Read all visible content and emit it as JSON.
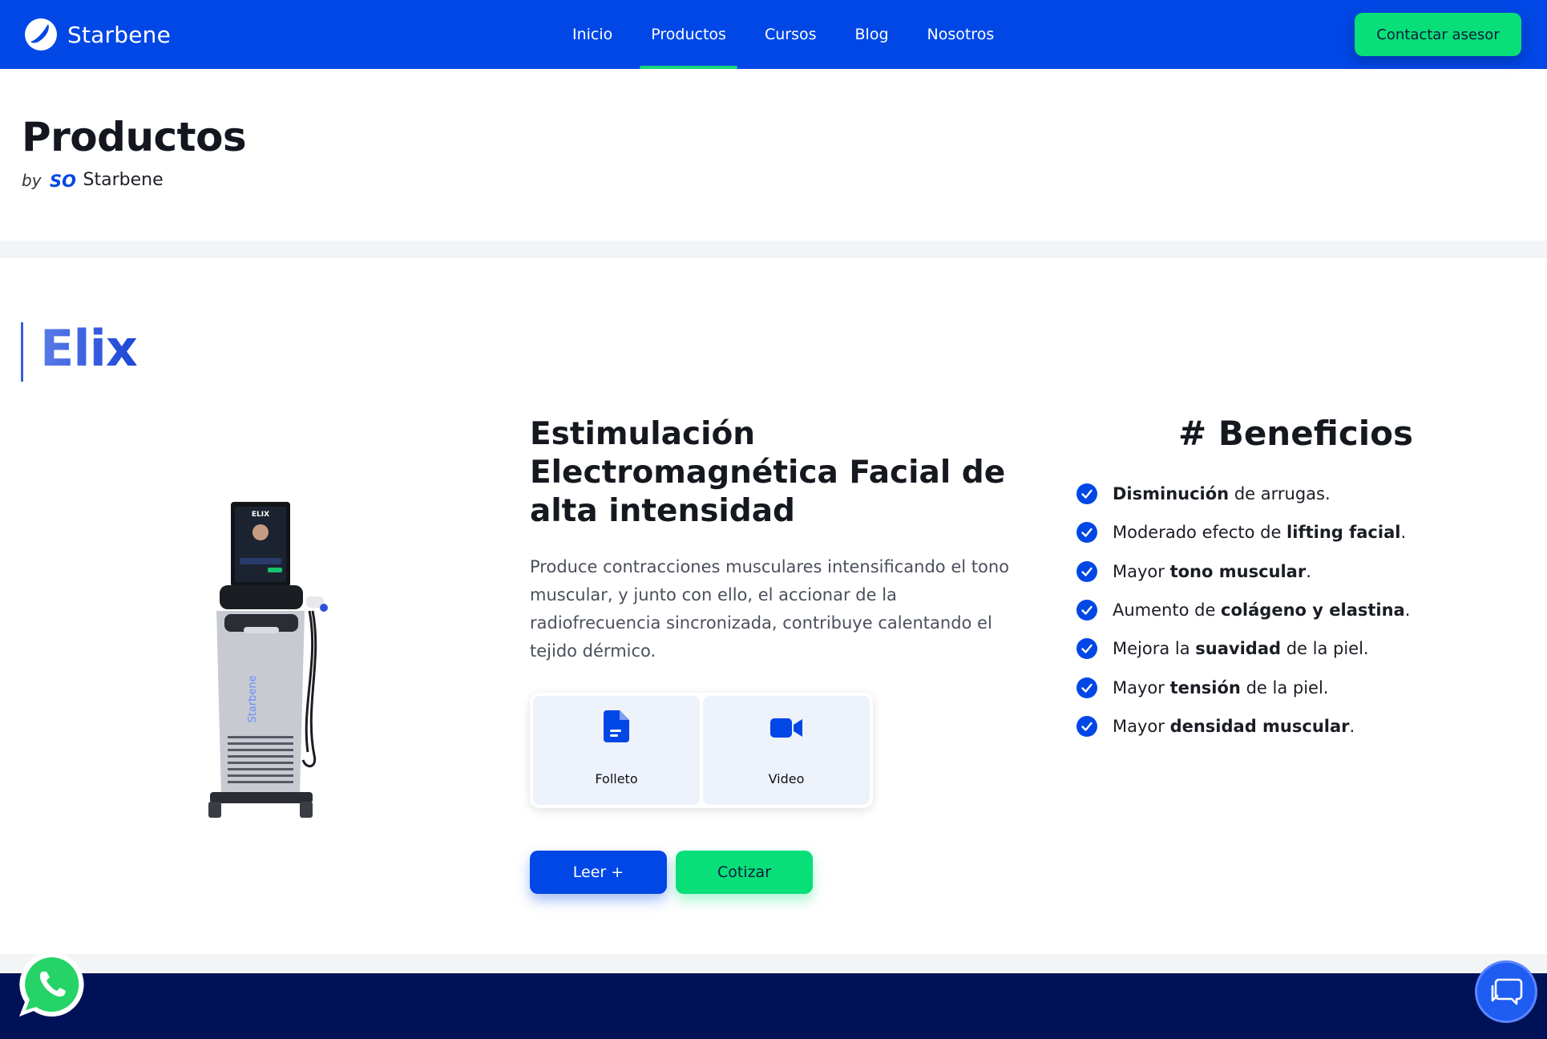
{
  "brand": {
    "name": "Starbene",
    "logo_icon": "swoosh-logo-icon"
  },
  "nav": {
    "items": [
      {
        "label": "Inicio",
        "active": false
      },
      {
        "label": "Productos",
        "active": true
      },
      {
        "label": "Cursos",
        "active": false
      },
      {
        "label": "Blog",
        "active": false
      },
      {
        "label": "Nosotros",
        "active": false
      }
    ],
    "cta_label": "Contactar asesor"
  },
  "page": {
    "title": "Productos",
    "by_word": "by",
    "by_brand": "Starbene",
    "by_logo_text": "SO"
  },
  "product": {
    "name": "Elix",
    "headline": "Estimulación Electromagnética Facial de alta intensidad",
    "description": "Produce contracciones musculares intensificando el tono muscular, y junto con ello, el accionar de la radiofrecuencia sincronizada, contribuye calentando el tejido dérmico.",
    "image_text": {
      "screen_brand": "ELIX",
      "body_brand": "Starbene"
    },
    "resources": [
      {
        "label": "Folleto",
        "icon": "document-icon"
      },
      {
        "label": "Video",
        "icon": "video-camera-icon"
      }
    ],
    "read_more_label": "Leer +",
    "quote_label": "Cotizar"
  },
  "benefits": {
    "title": "# Beneficios",
    "items": [
      {
        "pre": "",
        "bold": "Disminución",
        "post": " de arrugas."
      },
      {
        "pre": "Moderado efecto de ",
        "bold": "lifting facial",
        "post": "."
      },
      {
        "pre": "Mayor ",
        "bold": "tono muscular",
        "post": "."
      },
      {
        "pre": "Aumento de ",
        "bold": "colágeno y elastina",
        "post": "."
      },
      {
        "pre": "Mejora la ",
        "bold": "suavidad",
        "post": " de la piel."
      },
      {
        "pre": "Mayor ",
        "bold": "tensión",
        "post": " de la piel."
      },
      {
        "pre": "Mayor ",
        "bold": "densidad muscular",
        "post": "."
      }
    ]
  },
  "colors": {
    "primary_blue": "#0047e6",
    "accent_green": "#08df79",
    "footer_navy": "#001257",
    "whatsapp_green": "#25d366"
  },
  "floating": {
    "whatsapp_icon": "whatsapp-icon",
    "chat_icon": "chat-bubbles-icon"
  }
}
